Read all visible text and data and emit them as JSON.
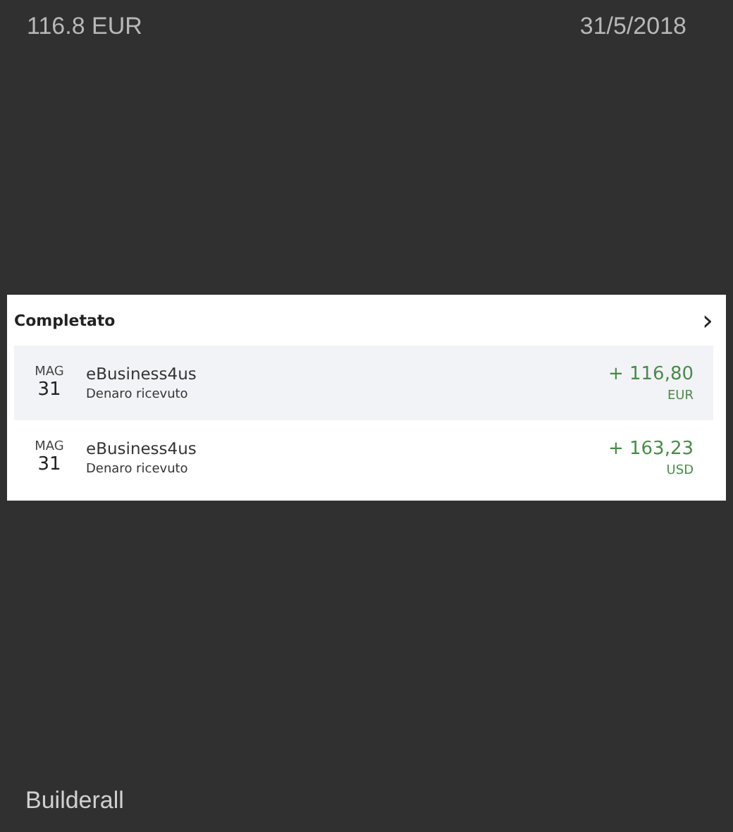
{
  "header": {
    "amount": "116.8 EUR",
    "date": "31/5/2018"
  },
  "activity": {
    "title": "Completato",
    "chevron": "›",
    "transactions": [
      {
        "month": "MAG",
        "day": "31",
        "name": "eBusiness4us",
        "description": "Denaro ricevuto",
        "amount": "+ 116,80",
        "currency": "EUR",
        "selected": true
      },
      {
        "month": "MAG",
        "day": "31",
        "name": "eBusiness4us",
        "description": "Denaro ricevuto",
        "amount": "+ 163,23",
        "currency": "USD",
        "selected": false
      }
    ]
  },
  "footer": {
    "label": "Builderall"
  }
}
